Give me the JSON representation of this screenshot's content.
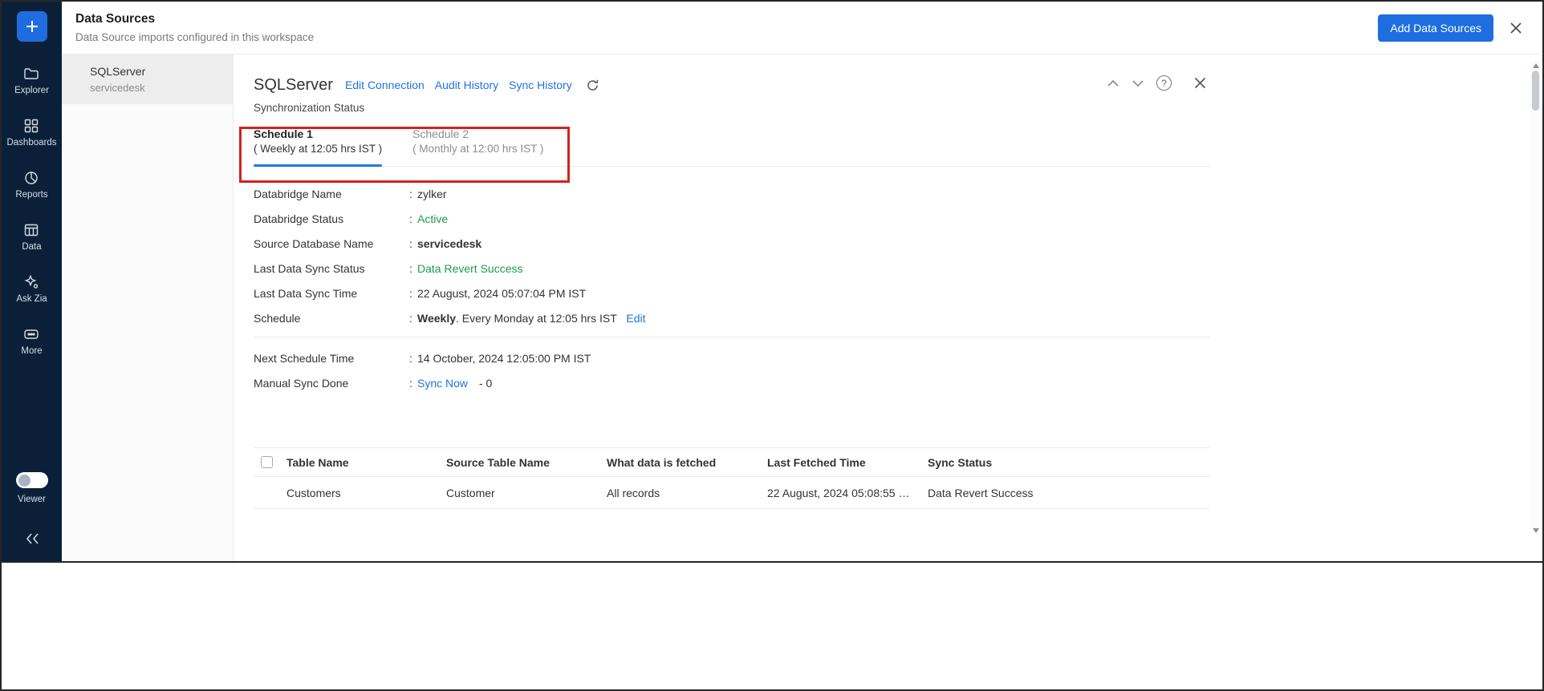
{
  "ui": {
    "colon": ":",
    "help_glyph": "?"
  },
  "sidebar": {
    "items": [
      {
        "label": "Explorer"
      },
      {
        "label": "Dashboards"
      },
      {
        "label": "Reports"
      },
      {
        "label": "Data"
      },
      {
        "label": "Ask Zia"
      },
      {
        "label": "More"
      }
    ],
    "viewer_label": "Viewer"
  },
  "header": {
    "title": "Data Sources",
    "subtitle": "Data Source imports configured in this workspace",
    "add_button_label": "Add Data Sources"
  },
  "source_list": {
    "selected": {
      "name": "SQLServer",
      "database": "servicedesk"
    }
  },
  "connection": {
    "title": "SQLServer",
    "links": [
      {
        "label": "Edit Connection"
      },
      {
        "label": "Audit History"
      },
      {
        "label": "Sync History"
      }
    ],
    "section_label": "Synchronization Status",
    "tabs": [
      {
        "label": "Schedule 1",
        "sublabel": "( Weekly at 12:05 hrs IST )"
      },
      {
        "label": "Schedule 2",
        "sublabel": "( Monthly at 12:00 hrs IST )"
      }
    ],
    "details": {
      "databridge_name": {
        "label": "Databridge Name",
        "value": "zylker"
      },
      "databridge_status": {
        "label": "Databridge Status",
        "value": "Active"
      },
      "source_database_name": {
        "label": "Source Database Name",
        "value": "servicedesk"
      },
      "last_sync_status": {
        "label": "Last Data Sync Status",
        "value": "Data Revert Success"
      },
      "last_sync_time": {
        "label": "Last Data Sync Time",
        "value": "22 August, 2024 05:07:04 PM IST"
      },
      "schedule": {
        "label": "Schedule",
        "frequency": "Weekly",
        "description": ". Every Monday at 12:05 hrs IST",
        "edit_label": "Edit"
      },
      "next_schedule_time": {
        "label": "Next Schedule Time",
        "value": "14 October, 2024 12:05:00 PM IST"
      },
      "manual_sync": {
        "label": "Manual Sync Done",
        "link_label": "Sync Now",
        "count": "- 0"
      }
    }
  },
  "tables_list": {
    "headers": [
      "Table Name",
      "Source Table Name",
      "What data is fetched",
      "Last Fetched Time",
      "Sync Status"
    ],
    "rows": [
      {
        "table_name": "Customers",
        "source_table_name": "Customer",
        "what_data": "All records",
        "last_fetched_time": "22 August, 2024 05:08:55 …",
        "sync_status": "Data Revert Success"
      }
    ]
  },
  "colors": {
    "accent_blue": "#1e6ee0",
    "link_blue": "#1d74e0",
    "success_green": "#1e9c4a",
    "annotation_red": "#d0241b",
    "sidebar_bg": "#0b2038",
    "active_tab_underline": "#2076e5"
  }
}
